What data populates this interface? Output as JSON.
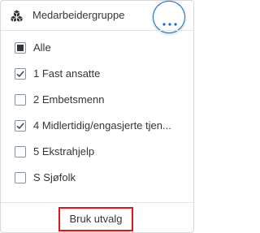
{
  "header": {
    "title": "Medarbeidergruppe",
    "icon": "cube-cluster-icon",
    "more_icon": "more-options-icon"
  },
  "items": [
    {
      "label": "Alle",
      "state": "partial"
    },
    {
      "label": "1 Fast ansatte",
      "state": "checked"
    },
    {
      "label": "2 Embetsmenn",
      "state": "unchecked"
    },
    {
      "label": "4 Midlertidig/engasjerte tjen...",
      "state": "checked"
    },
    {
      "label": "5 Ekstrahjelp",
      "state": "unchecked"
    },
    {
      "label": "S Sjøfolk",
      "state": "unchecked"
    }
  ],
  "footer": {
    "apply_label": "Bruk utvalg"
  },
  "colors": {
    "accent": "#0a6ed1",
    "highlight": "#e0161b",
    "text": "#32363a",
    "checkbox_border": "#89919a"
  }
}
